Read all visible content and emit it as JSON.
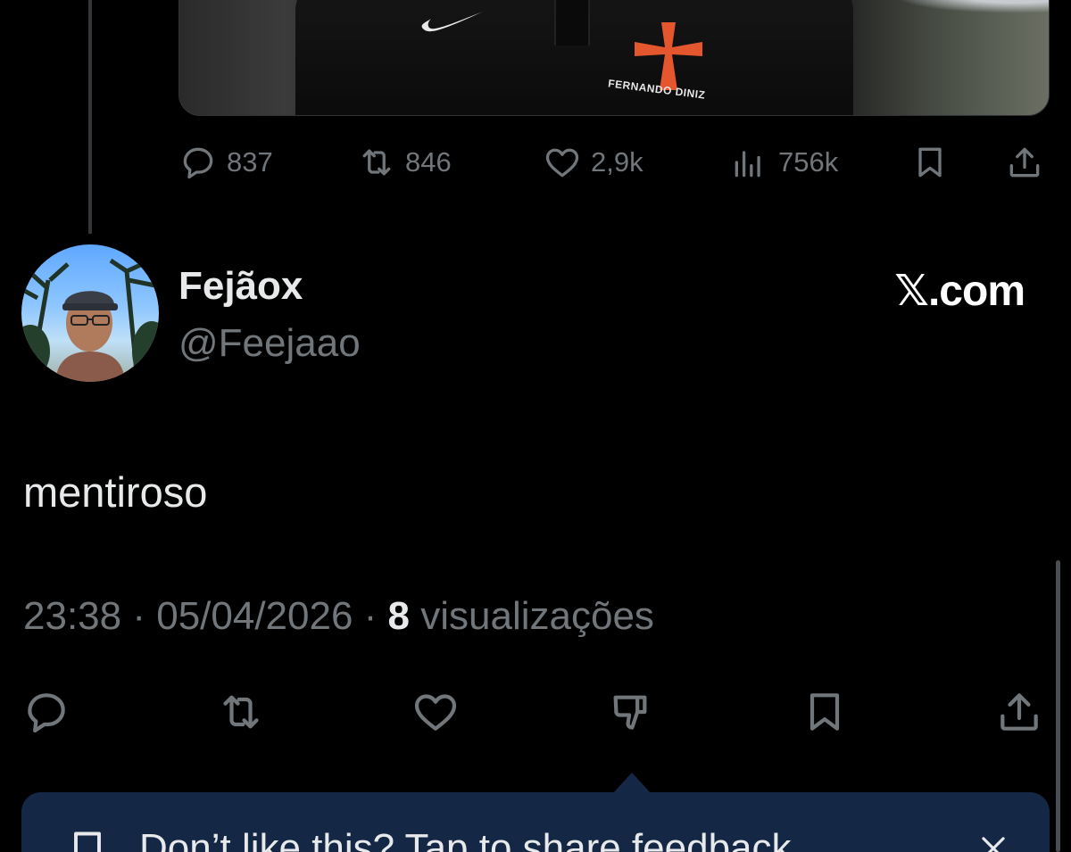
{
  "parent_tweet": {
    "media": {
      "jersey_text": "FERNANDO DINIZ",
      "icons": [
        "swoosh-logo",
        "maltese-cross-crest"
      ]
    },
    "actions": {
      "replies": "837",
      "reposts": "846",
      "likes": "2,9k",
      "views": "756k"
    },
    "icons": [
      "reply-icon",
      "repost-icon",
      "like-icon",
      "views-icon",
      "bookmark-icon",
      "share-icon"
    ]
  },
  "reply": {
    "author_name": "Fejãox",
    "author_handle": "@Feejaao",
    "brand": "𝕏.com",
    "text": "mentiroso",
    "meta": {
      "time": "23:38",
      "separator1": " · ",
      "date": "05/04/2026",
      "separator2": " · ",
      "views_count": "8",
      "views_label": " visualizações"
    },
    "icons": [
      "reply-icon",
      "repost-icon",
      "like-icon",
      "downvote-icon",
      "bookmark-icon",
      "share-icon"
    ]
  },
  "feedback_banner": {
    "text": "Don’t like this? Tap to share feedback",
    "icons": [
      "feedback-icon",
      "close-icon"
    ]
  },
  "colors": {
    "background": "#000000",
    "text": "#e7e9ea",
    "muted": "#71767b",
    "banner": "#142846",
    "crest": "#e4572e"
  }
}
